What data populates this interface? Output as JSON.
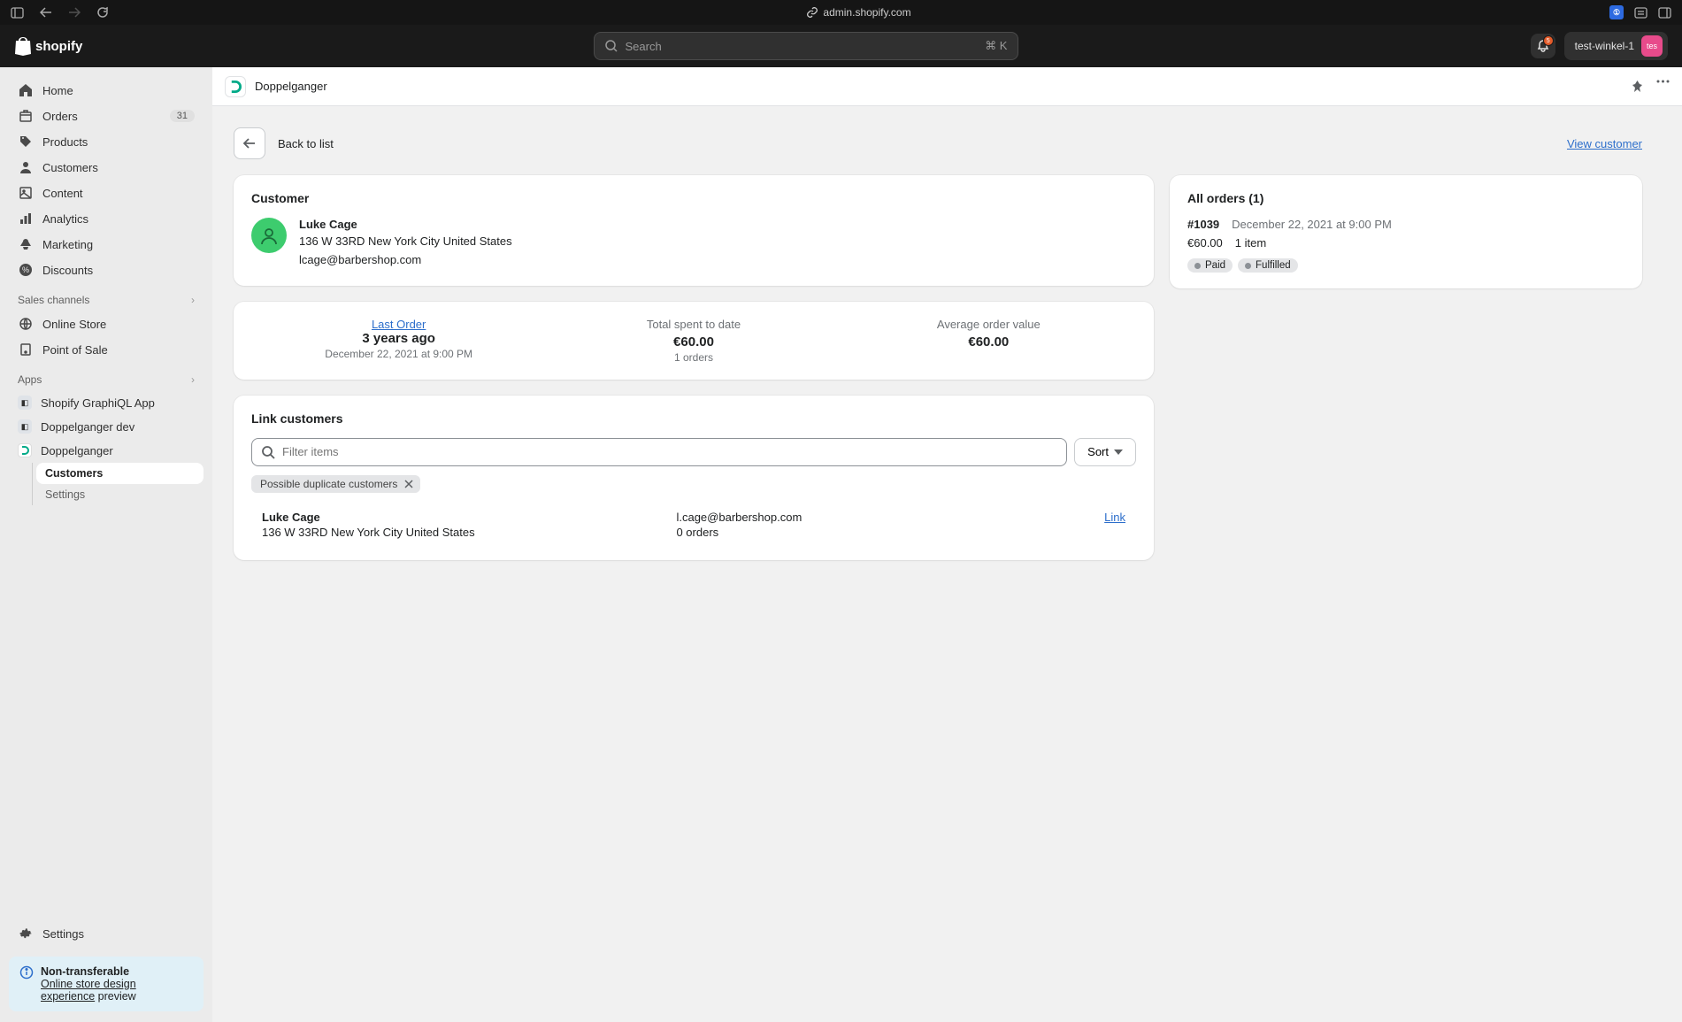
{
  "browser": {
    "url": "admin.shopify.com"
  },
  "topbar": {
    "brand": "shopify",
    "search_placeholder": "Search",
    "search_kbd": "⌘ K",
    "notif_count": "5",
    "store_name": "test-winkel-1",
    "store_initials": "tes"
  },
  "sidebar": {
    "home": "Home",
    "orders": "Orders",
    "orders_badge": "31",
    "products": "Products",
    "customers": "Customers",
    "content": "Content",
    "analytics": "Analytics",
    "marketing": "Marketing",
    "discounts": "Discounts",
    "sales_channels": "Sales channels",
    "online_store": "Online Store",
    "pos": "Point of Sale",
    "apps": "Apps",
    "app_graphiql": "Shopify GraphiQL App",
    "app_dg_dev": "Doppelganger dev",
    "app_dg": "Doppelganger",
    "app_dg_customers": "Customers",
    "app_dg_settings": "Settings",
    "settings": "Settings",
    "notice_title": "Non-transferable",
    "notice_link": "Online store design experience",
    "notice_suffix": " preview"
  },
  "strip": {
    "title": "Doppelganger"
  },
  "page": {
    "back": "Back to list",
    "view_customer": "View customer"
  },
  "customer": {
    "title": "Customer",
    "name": "Luke Cage",
    "address": "136 W 33RD New York City United States",
    "email": "lcage@barbershop.com"
  },
  "stats": {
    "last_order_label": "Last Order",
    "last_order_value": "3 years ago",
    "last_order_sub": "December 22, 2021 at 9:00 PM",
    "total_spent_label": "Total spent to date",
    "total_spent_value": "€60.00",
    "total_spent_sub": "1 orders",
    "aov_label": "Average order value",
    "aov_value": "€60.00"
  },
  "link": {
    "title": "Link customers",
    "filter_placeholder": "Filter items",
    "sort": "Sort",
    "tag": "Possible duplicate customers",
    "row_name": "Luke Cage",
    "row_addr": "136 W 33RD New York City United States",
    "row_email": "l.cage@barbershop.com",
    "row_orders": "0 orders",
    "action": "Link"
  },
  "orders": {
    "title": "All orders (1)",
    "id": "#1039",
    "date": "December 22, 2021 at 9:00 PM",
    "amount": "€60.00",
    "items": "1 item",
    "badge_paid": "Paid",
    "badge_fulfilled": "Fulfilled"
  }
}
